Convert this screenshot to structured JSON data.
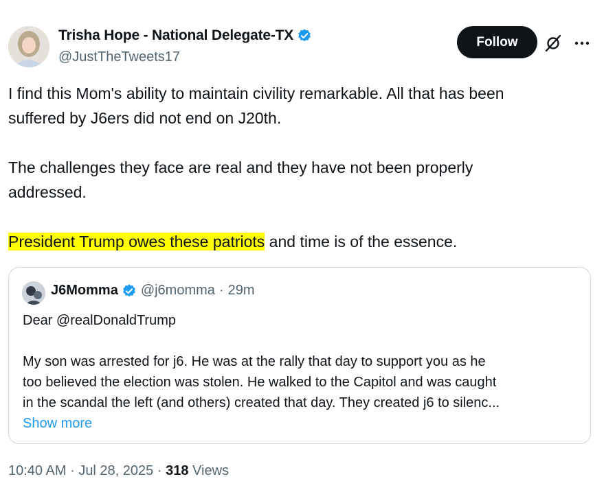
{
  "author": {
    "name": "Trisha Hope - National Delegate-TX",
    "handle": "@JustTheTweets17",
    "verified": true
  },
  "actions": {
    "follow_label": "Follow",
    "grok_icon": "grok-icon",
    "more_icon": "more-icon"
  },
  "tweet": {
    "line1": "I find this Mom's ability to maintain civility remarkable.  All that has been",
    "line2": "suffered by J6ers did not end on J20th.",
    "line3": "The challenges they face are real and they have not been properly",
    "line4": "addressed.",
    "highlight": "President Trump owes these patriots",
    "line5_rest": " and time is of the essence."
  },
  "quote": {
    "name": "J6Momma",
    "handle": "@j6momma",
    "separator": "·",
    "time": "29m",
    "line1": "Dear @realDonaldTrump",
    "line2": "My son was arrested for j6. He  was at the rally that day to support you as he",
    "line3": "too believed the election was stolen. He walked to the Capitol and was caught",
    "line4": "in the scandal the left (and others) created that day. They created j6 to silenc...",
    "show_more": "Show more"
  },
  "meta": {
    "time": "10:40 AM",
    "separator": "·",
    "date": "Jul 28, 2025",
    "views_count": "318",
    "views_label": "Views"
  },
  "colors": {
    "text": "#0f1419",
    "secondary": "#536471",
    "link": "#1d9bf0",
    "highlight": "#ffff00",
    "verified": "#1d9bf0"
  }
}
